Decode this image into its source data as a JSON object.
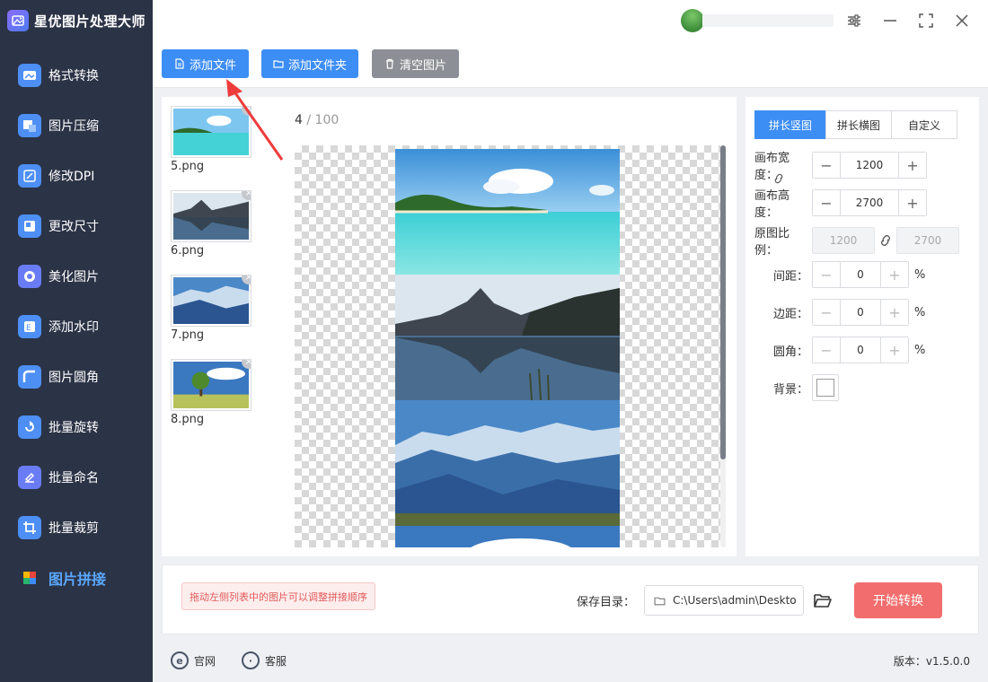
{
  "app": {
    "title": "星优图片处理大师"
  },
  "sidebar": {
    "items": [
      {
        "label": "格式转换",
        "icon": "format-convert-icon",
        "color": "#4d8ff5"
      },
      {
        "label": "图片压缩",
        "icon": "compress-icon",
        "color": "#4d8ff5"
      },
      {
        "label": "修改DPI",
        "icon": "dpi-icon",
        "color": "#4d8ff5"
      },
      {
        "label": "更改尺寸",
        "icon": "resize-icon",
        "color": "#4d8ff5"
      },
      {
        "label": "美化图片",
        "icon": "beautify-icon",
        "color": "#6a7cf5"
      },
      {
        "label": "添加水印",
        "icon": "watermark-icon",
        "color": "#4d8ff5"
      },
      {
        "label": "图片圆角",
        "icon": "round-corner-icon",
        "color": "#4d8ff5"
      },
      {
        "label": "批量旋转",
        "icon": "rotate-icon",
        "color": "#4d8ff5"
      },
      {
        "label": "批量命名",
        "icon": "rename-icon",
        "color": "#6a7cf5"
      },
      {
        "label": "批量裁剪",
        "icon": "crop-icon",
        "color": "#4d8ff5"
      },
      {
        "label": "图片拼接",
        "icon": "stitch-icon",
        "color": "#f5b400",
        "active": true
      }
    ]
  },
  "toolbar": {
    "add_file": "添加文件",
    "add_folder": "添加文件夹",
    "clear": "清空图片"
  },
  "files": [
    {
      "name": "5.png"
    },
    {
      "name": "6.png"
    },
    {
      "name": "7.png"
    },
    {
      "name": "8.png"
    }
  ],
  "counter": {
    "current": "4",
    "separator": " / ",
    "total": "100"
  },
  "settings": {
    "tabs": [
      "拼长竖图",
      "拼长横图",
      "自定义"
    ],
    "active_tab": 0,
    "canvas_width_label": "画布宽度：",
    "canvas_width": "1200",
    "canvas_height_label": "画布高度：",
    "canvas_height": "2700",
    "ratio_label": "原图比例：",
    "ratio_w": "1200",
    "ratio_h": "2700",
    "spacing_label": "间距：",
    "spacing": "0",
    "margin_label": "边距：",
    "margin": "0",
    "radius_label": "圆角：",
    "radius": "0",
    "unit": "%",
    "background_label": "背景："
  },
  "bottom": {
    "hint": "拖动左侧列表中的图片可以调整拼接顺序",
    "save_label": "保存目录：",
    "save_path": "C:\\Users\\admin\\Deskto",
    "start": "开始转换"
  },
  "footer": {
    "official": "官网",
    "service": "客服",
    "version": "版本：v1.5.0.0"
  },
  "colors": {
    "accent": "#3d8ef4",
    "start_button": "#f26d6d",
    "sidebar_bg": "#2b3346",
    "annotation_arrow": "#ee3b3b"
  }
}
